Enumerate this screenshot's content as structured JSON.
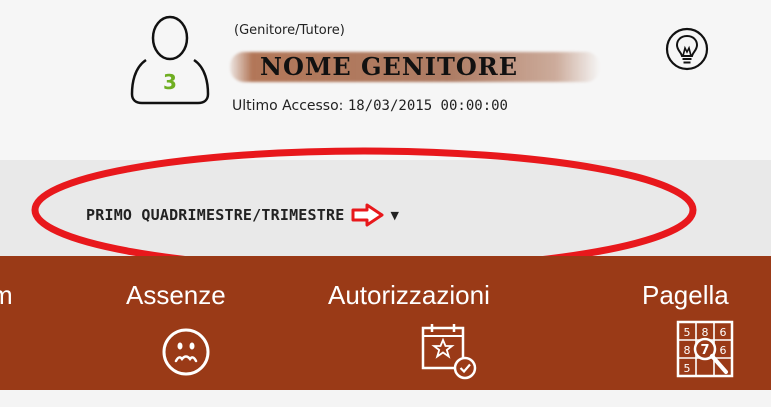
{
  "header": {
    "role": "(Genitore/Tutore)",
    "parent_name": "NOME GENITORE",
    "avatar_badge": "3",
    "last_access_label": "Ultimo Accesso:",
    "last_access_value": "18/03/2015 00:00:00",
    "icons": [
      "user-avatar-icon",
      "lightbulb-icon"
    ]
  },
  "period": {
    "selected": "PRIMO QUADRIMESTRE/TRIMESTRE",
    "icons": [
      "red-arrow-icon",
      "dropdown-caret-icon"
    ]
  },
  "nav": {
    "items": [
      {
        "label": "m"
      },
      {
        "label": "Assenze",
        "icon": "sad-face-icon"
      },
      {
        "label": "Autorizzazioni",
        "icon": "calendar-check-icon"
      },
      {
        "label": "Pagella",
        "icon": "report-card-icon"
      }
    ]
  },
  "colors": {
    "nav_bg": "#9a3a17",
    "highlight": "#e8181c",
    "badge": "#6fae22",
    "header_bg": "#f6f6f6",
    "period_bg": "#e9e9e9"
  }
}
